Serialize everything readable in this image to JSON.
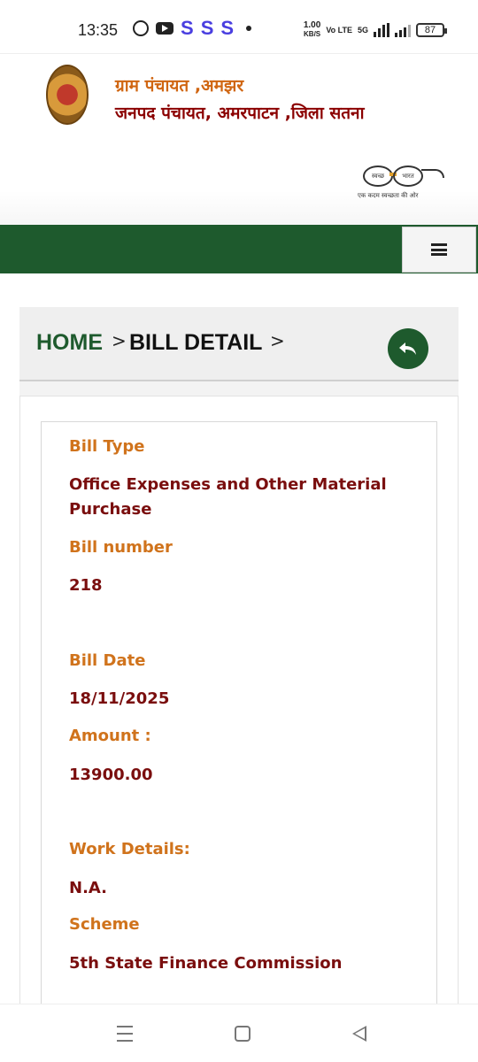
{
  "status_bar": {
    "time": "13:35",
    "s_icons": [
      "S",
      "S",
      "S"
    ],
    "speed_value": "1.00",
    "speed_unit": "KB/S",
    "network_type": "5G",
    "volte": "Vo LTE",
    "battery": "87"
  },
  "header": {
    "line1": "ग्राम पंचायत ,अमझर",
    "line2": "जनपद पंचायत, अमरपाटन ,जिला सतना",
    "swachh_left": "स्वच्छ",
    "swachh_right": "भारत",
    "swachh_tagline": "एक कदम स्वच्छता की ओर"
  },
  "breadcrumb": {
    "home": "HOME",
    "separator": ">",
    "current": "BILL DETAIL"
  },
  "bill": {
    "type_label": "Bill Type",
    "type_value": "Office Expenses and Other Material Purchase",
    "number_label": "Bill number",
    "number_value": "218",
    "date_label": "Bill Date",
    "date_value": "18/11/2025",
    "amount_label": "Amount :",
    "amount_value": "13900.00",
    "work_label": "Work Details:",
    "work_value": "N.A.",
    "scheme_label": "Scheme",
    "scheme_value": "5th State Finance Commission"
  },
  "colors": {
    "nav_green": "#1e5a2d",
    "label_orange": "#d0731c",
    "value_maroon": "#7a0e0e",
    "title_orange": "#d06612"
  }
}
